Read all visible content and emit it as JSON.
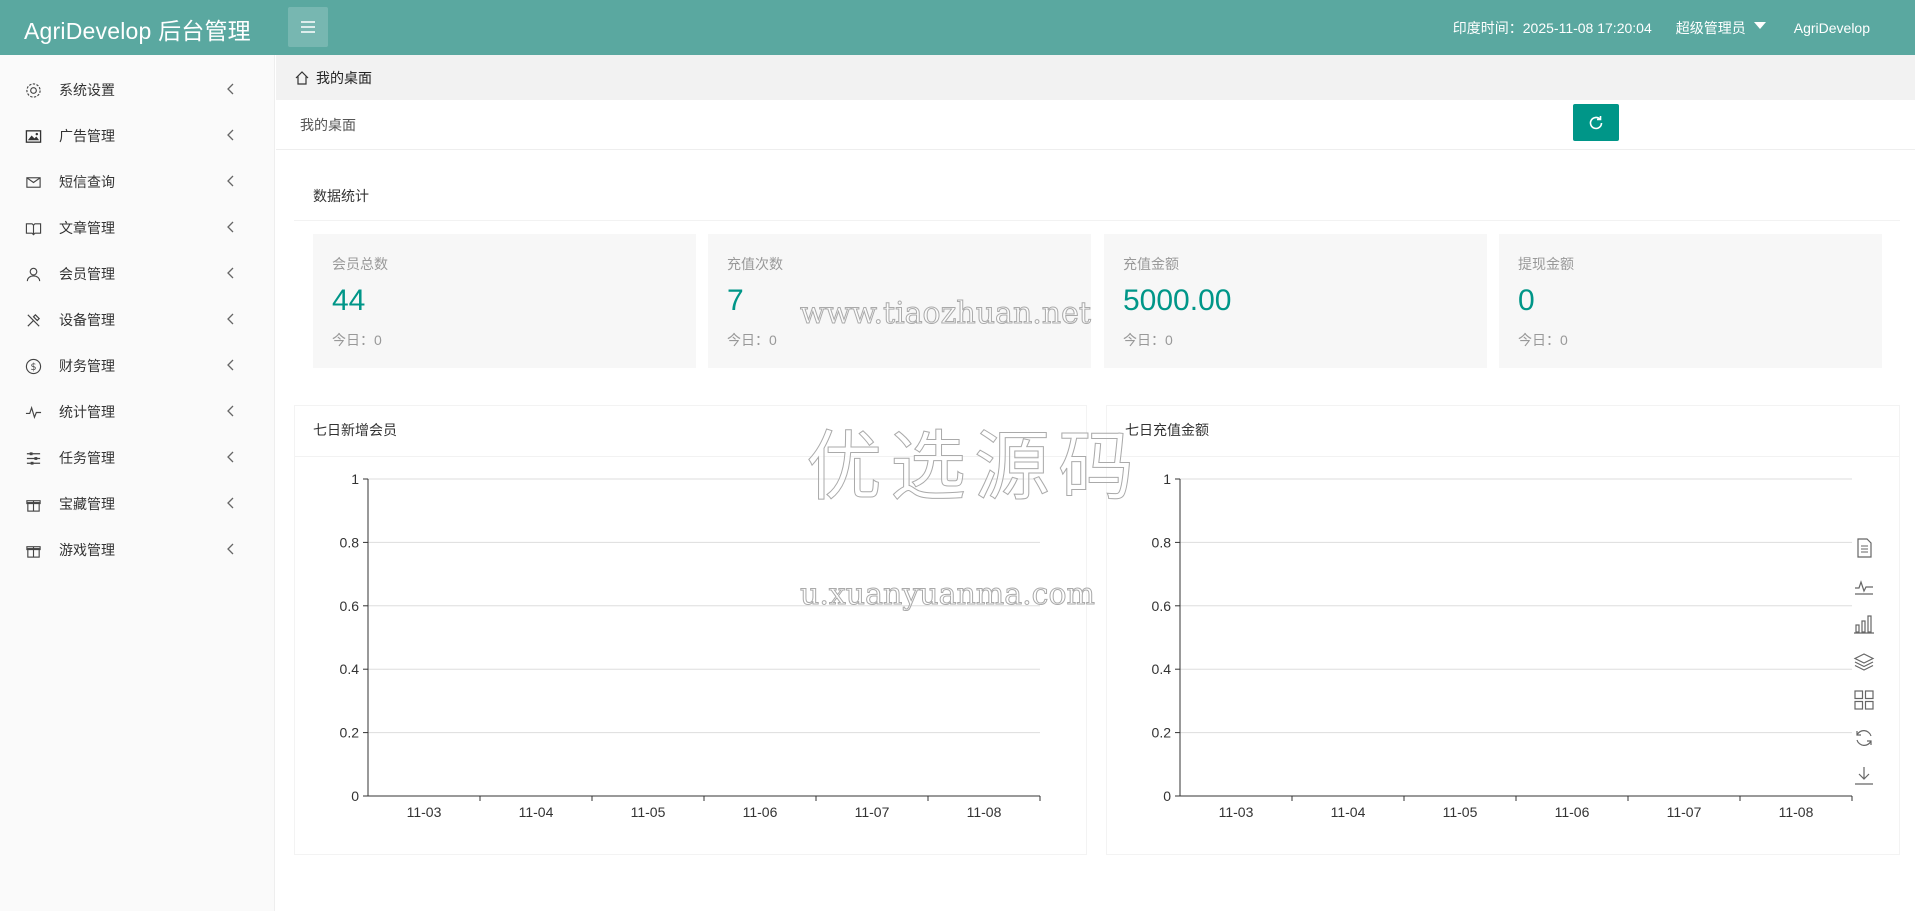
{
  "header": {
    "logo": "AgriDevelop 后台管理",
    "time_label": "印度时间：2025-11-08 17:20:04",
    "admin_label": "超级管理员",
    "user_label": "AgriDevelop"
  },
  "sidebar": {
    "items": [
      {
        "label": "系统设置",
        "icon": "gear-icon"
      },
      {
        "label": "广告管理",
        "icon": "image-icon"
      },
      {
        "label": "短信查询",
        "icon": "mail-icon"
      },
      {
        "label": "文章管理",
        "icon": "book-icon"
      },
      {
        "label": "会员管理",
        "icon": "user-icon"
      },
      {
        "label": "设备管理",
        "icon": "tools-icon"
      },
      {
        "label": "财务管理",
        "icon": "dollar-icon"
      },
      {
        "label": "统计管理",
        "icon": "pulse-icon"
      },
      {
        "label": "任务管理",
        "icon": "sliders-icon"
      },
      {
        "label": "宝藏管理",
        "icon": "gift-icon"
      },
      {
        "label": "游戏管理",
        "icon": "gift-icon"
      }
    ]
  },
  "breadcrumb": {
    "label": "我的桌面"
  },
  "page": {
    "title": "我的桌面"
  },
  "stats": {
    "title": "数据统计",
    "boxes": [
      {
        "label": "会员总数",
        "value": "44",
        "today": "今日：0"
      },
      {
        "label": "充值次数",
        "value": "7",
        "today": "今日：0"
      },
      {
        "label": "充值金额",
        "value": "5000.00",
        "today": "今日：0"
      },
      {
        "label": "提现金额",
        "value": "0",
        "today": "今日：0"
      }
    ]
  },
  "charts": [
    {
      "title": "七日新增会员"
    },
    {
      "title": "七日充值金额"
    }
  ],
  "chart_data": [
    {
      "type": "line",
      "title": "七日新增会员",
      "categories": [
        "11-03",
        "11-04",
        "11-05",
        "11-06",
        "11-07",
        "11-08"
      ],
      "series": [
        {
          "values": [
            0,
            0,
            0,
            0,
            0,
            0
          ]
        }
      ],
      "ylim": [
        0,
        1
      ],
      "yticks": [
        "0",
        "0.2",
        "0.4",
        "0.6",
        "0.8",
        "1"
      ],
      "grid": true
    },
    {
      "type": "line",
      "title": "七日充值金额",
      "categories": [
        "11-03",
        "11-04",
        "11-05",
        "11-06",
        "11-07",
        "11-08"
      ],
      "series": [
        {
          "values": [
            0,
            0,
            0,
            0,
            0,
            0
          ]
        }
      ],
      "ylim": [
        0,
        1
      ],
      "yticks": [
        "0",
        "0.2",
        "0.4",
        "0.6",
        "0.8",
        "1"
      ],
      "grid": true
    }
  ],
  "toolbox": [
    "data-view-icon",
    "line-icon",
    "bar-icon",
    "stack-icon",
    "tiled-icon",
    "restore-icon",
    "download-icon"
  ],
  "watermark": {
    "line1": "www.tiaozhuan.net",
    "line2": "优选源码",
    "line3": "u.xuanyuanma.com"
  },
  "colors": {
    "header": "#5aa8a0",
    "accent": "#009688"
  }
}
